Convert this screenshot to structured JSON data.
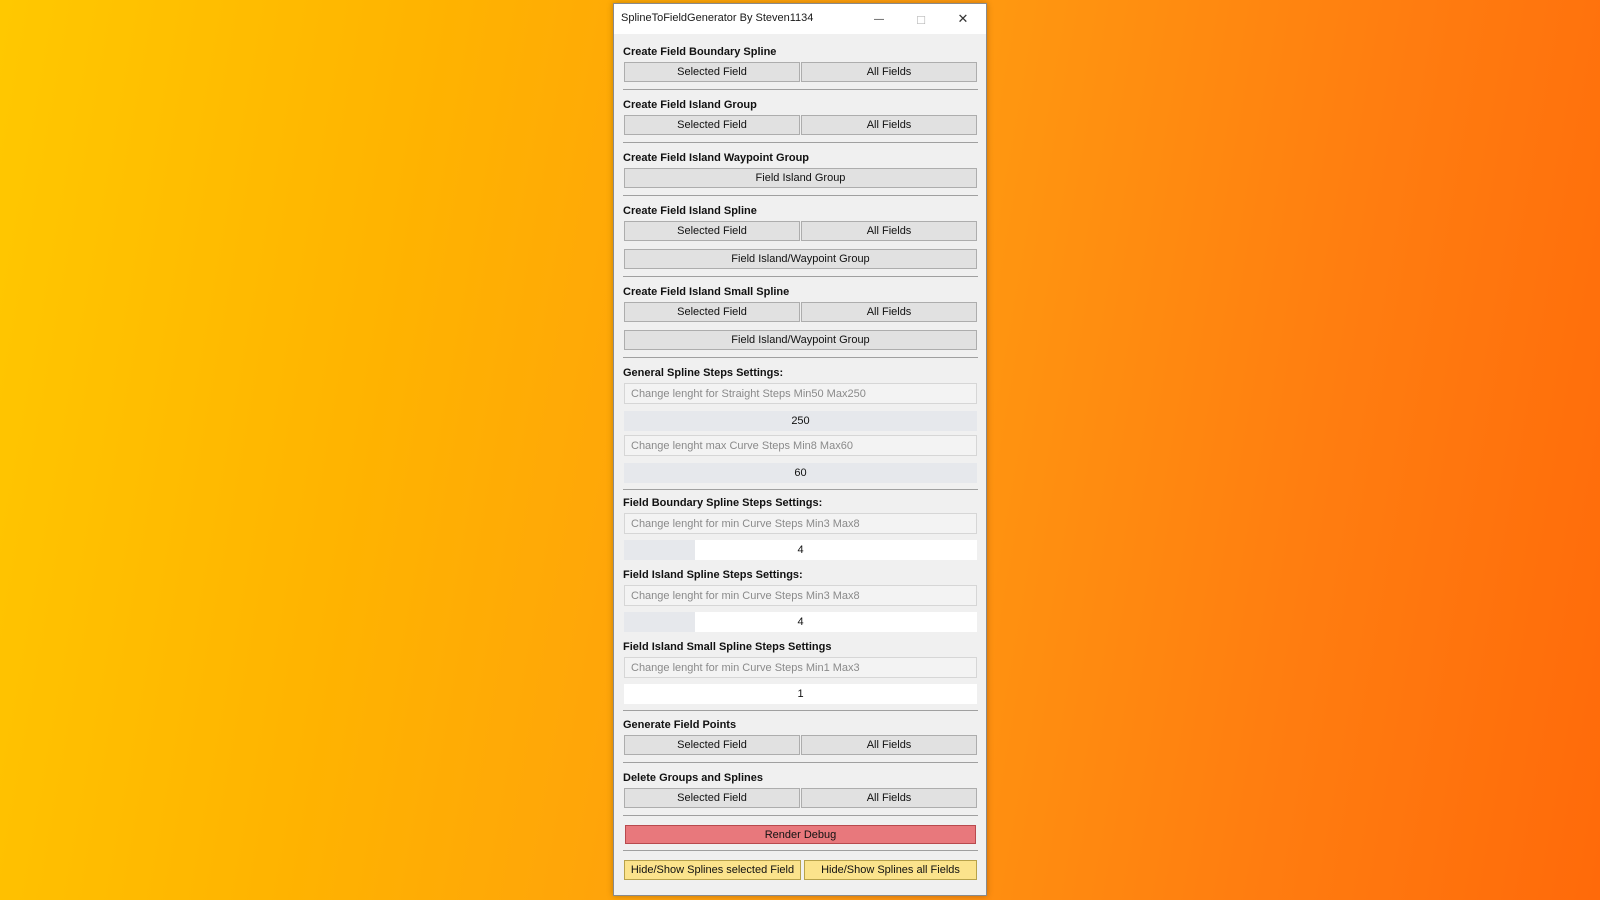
{
  "window": {
    "title": "SplineToFieldGenerator By Steven1134",
    "minimize_icon": "—",
    "maximize_icon": "□",
    "close_icon": "✕"
  },
  "sections": {
    "boundary_spline": {
      "heading": "Create Field Boundary Spline",
      "selected": "Selected Field",
      "all": "All Fields"
    },
    "island_group": {
      "heading": "Create Field Island Group",
      "selected": "Selected Field",
      "all": "All Fields"
    },
    "waypoint_group": {
      "heading": "Create Field Island Waypoint Group",
      "field_island_group": "Field Island Group"
    },
    "island_spline": {
      "heading": "Create Field Island Spline",
      "selected": "Selected Field",
      "all": "All Fields",
      "waypoint": "Field Island/Waypoint Group"
    },
    "small_spline": {
      "heading": "Create Field Island Small Spline",
      "selected": "Selected Field",
      "all": "All Fields",
      "waypoint": "Field Island/Waypoint Group"
    },
    "general_steps": {
      "heading": "General Spline Steps Settings:",
      "straight_placeholder": "Change lenght for Straight Steps Min50 Max250",
      "straight_value": "250",
      "straight_fraction": 1.0,
      "curve_placeholder": "Change lenght max Curve Steps Min8 Max60",
      "curve_value": "60",
      "curve_fraction": 1.0
    },
    "boundary_steps": {
      "heading": "Field Boundary Spline Steps Settings:",
      "placeholder": "Change lenght for min Curve Steps Min3 Max8",
      "value": "4",
      "fraction": 0.2
    },
    "island_steps": {
      "heading": "Field Island Spline Steps Settings:",
      "placeholder": "Change lenght for min Curve Steps Min3 Max8",
      "value": "4",
      "fraction": 0.2
    },
    "small_steps": {
      "heading": "Field Island Small Spline Steps Settings",
      "placeholder": "Change lenght for min Curve Steps Min1 Max3",
      "value": "1",
      "fraction": 0.0
    },
    "field_points": {
      "heading": "Generate Field Points",
      "selected": "Selected Field",
      "all": "All Fields"
    },
    "delete": {
      "heading": "Delete Groups and Splines",
      "selected": "Selected Field",
      "all": "All Fields"
    }
  },
  "render_debug": "Render Debug",
  "hide_show": {
    "selected": "Hide/Show Splines selected Field",
    "all": "Hide/Show Splines all Fields"
  },
  "colors": {
    "render_debug": "#e8787c",
    "hide_show": "#fbe38c"
  }
}
